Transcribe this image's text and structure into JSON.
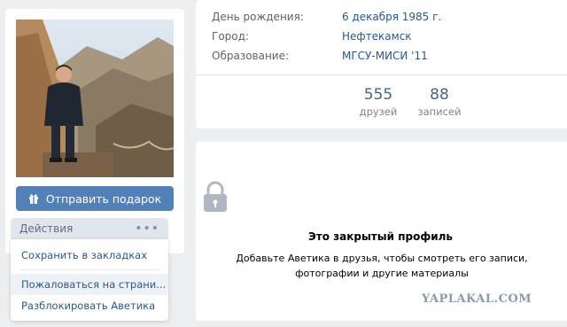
{
  "profile_actions": {
    "gift_button_label": "Отправить подарок",
    "actions_label": "Действия",
    "menu_items": [
      "Сохранить в закладках",
      "Пожаловаться на страни...",
      "Разблокировать Аветика"
    ]
  },
  "info": {
    "rows": [
      {
        "label": "День рождения:",
        "value": "6 декабря 1985 г."
      },
      {
        "label": "Город:",
        "value": "Нефтекамск"
      },
      {
        "label": "Образование:",
        "value": "МГСУ-МИСИ '11"
      }
    ],
    "stats": [
      {
        "count": "555",
        "label": "друзей"
      },
      {
        "count": "88",
        "label": "записей"
      }
    ]
  },
  "private_profile": {
    "title": "Это закрытый профиль",
    "text_line1": "Добавьте Аветика в друзья, чтобы смотреть его записи,",
    "text_line2": "фотографии и другие материалы"
  },
  "colors": {
    "accent": "#5181b8",
    "link": "#2a5885",
    "background": "#edeef0"
  }
}
